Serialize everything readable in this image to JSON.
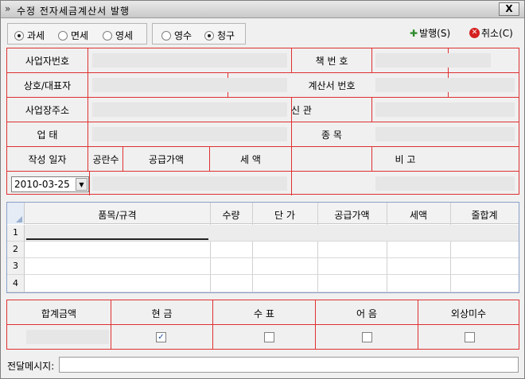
{
  "window": {
    "title": "수정 전자세금계산서 발행",
    "close": "X"
  },
  "tax_type": {
    "options": [
      {
        "label": "과세",
        "selected": true
      },
      {
        "label": "면세",
        "selected": false
      },
      {
        "label": "영세",
        "selected": false
      }
    ]
  },
  "receipt_type": {
    "options": [
      {
        "label": "영수",
        "selected": false
      },
      {
        "label": "청구",
        "selected": true
      }
    ]
  },
  "toolbar": {
    "issue_label": "발행(S)",
    "cancel_label": "취소(C)"
  },
  "form": {
    "business_no_label": "사업자번호",
    "book_no_label": "책 번 호",
    "company_label": "상호/대표자",
    "invoice_no_label": "계산서 번호",
    "address_label": "사업장주소",
    "relation_label": "신 관",
    "business_type_label": "업      태",
    "item_label": "종      목",
    "date_label": "작성 일자",
    "blank_count_label": "공란수",
    "supply_amount_label": "공급가액",
    "tax_label": "세      액",
    "note_label": "비                 고",
    "date_value": "2010-03-25"
  },
  "grid": {
    "columns": [
      "품목/규격",
      "수량",
      "단      가",
      "공급가액",
      "세액",
      "줄합계"
    ],
    "rows": [
      "1",
      "2",
      "3",
      "4"
    ]
  },
  "totals": {
    "total_label": "합계금액",
    "cash_label": "현      금",
    "check_label": "수      표",
    "bill_label": "어      음",
    "credit_label": "외상미수",
    "cash_checked": true,
    "check_checked": false,
    "bill_checked": false,
    "credit_checked": false
  },
  "message": {
    "label": "전달메시지:",
    "value": ""
  },
  "colors": {
    "border_red": "#e03030",
    "grid_blue": "#8aa0c8"
  }
}
